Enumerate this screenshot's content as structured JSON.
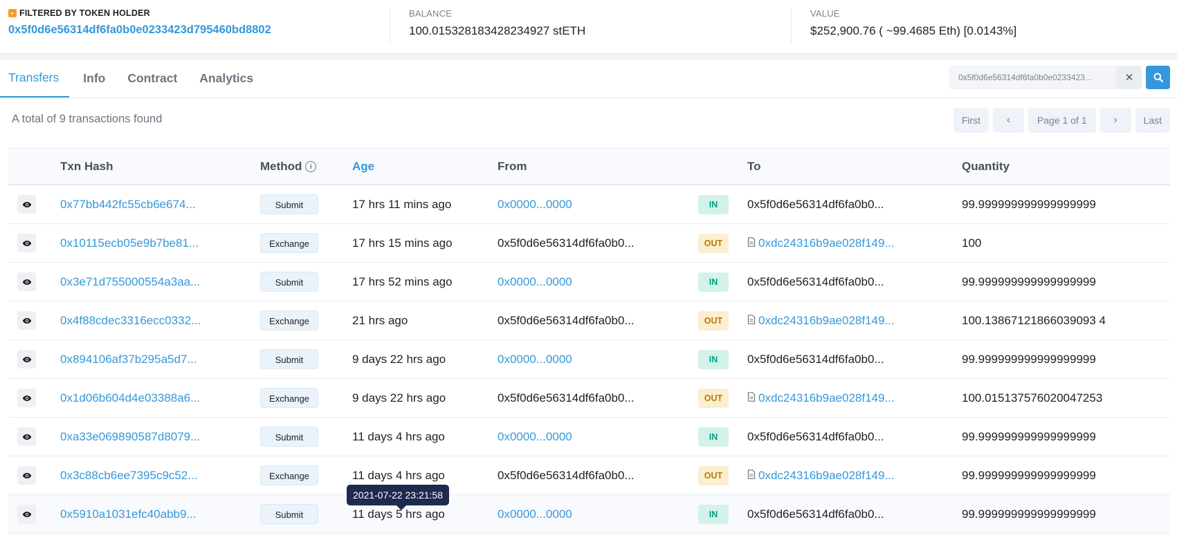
{
  "summary": {
    "filter_label": "FILTERED BY TOKEN HOLDER",
    "filter_address": "0x5f0d6e56314df6fa0b0e0233423d795460bd8802",
    "balance_label": "BALANCE",
    "balance_value": "100.015328183428234927 stETH",
    "value_label": "VALUE",
    "value_value": "$252,900.76 ( ~99.4685 Eth) [0.0143%]"
  },
  "tabs": [
    {
      "label": "Transfers",
      "active": true
    },
    {
      "label": "Info",
      "active": false
    },
    {
      "label": "Contract",
      "active": false
    },
    {
      "label": "Analytics",
      "active": false
    }
  ],
  "search": {
    "value": "0x5f0d6e56314df6fa0b0e0233423d795460bd8802",
    "display": "0x5f0d6e56314df6fa0b0e0233423..."
  },
  "total_text": "A total of 9 transactions found",
  "pager": {
    "first": "First",
    "prev": "‹",
    "info": "Page 1 of 1",
    "next": "›",
    "last": "Last"
  },
  "table": {
    "headers": {
      "txn_hash": "Txn Hash",
      "method": "Method",
      "age": "Age",
      "from": "From",
      "to": "To",
      "quantity": "Quantity"
    },
    "rows": [
      {
        "hash": "0x77bb442fc55cb6e674...",
        "method": "Submit",
        "age": "17 hrs 11 mins ago",
        "from": "0x0000...0000",
        "from_link": true,
        "dir": "IN",
        "to": "0x5f0d6e56314df6fa0b0...",
        "to_contract": false,
        "qty": "99.999999999999999999"
      },
      {
        "hash": "0x10115ecb05e9b7be81...",
        "method": "Exchange",
        "age": "17 hrs 15 mins ago",
        "from": "0x5f0d6e56314df6fa0b0...",
        "from_link": false,
        "dir": "OUT",
        "to": "0xdc24316b9ae028f149...",
        "to_contract": true,
        "qty": "100"
      },
      {
        "hash": "0x3e71d755000554a3aa...",
        "method": "Submit",
        "age": "17 hrs 52 mins ago",
        "from": "0x0000...0000",
        "from_link": true,
        "dir": "IN",
        "to": "0x5f0d6e56314df6fa0b0...",
        "to_contract": false,
        "qty": "99.999999999999999999"
      },
      {
        "hash": "0x4f88cdec3316ecc0332...",
        "method": "Exchange",
        "age": "21 hrs ago",
        "from": "0x5f0d6e56314df6fa0b0...",
        "from_link": false,
        "dir": "OUT",
        "to": "0xdc24316b9ae028f149...",
        "to_contract": true,
        "qty": "100.13867121866039093 4"
      },
      {
        "hash": "0x894106af37b295a5d7...",
        "method": "Submit",
        "age": "9 days 22 hrs ago",
        "from": "0x0000...0000",
        "from_link": true,
        "dir": "IN",
        "to": "0x5f0d6e56314df6fa0b0...",
        "to_contract": false,
        "qty": "99.999999999999999999"
      },
      {
        "hash": "0x1d06b604d4e03388a6...",
        "method": "Exchange",
        "age": "9 days 22 hrs ago",
        "from": "0x5f0d6e56314df6fa0b0...",
        "from_link": false,
        "dir": "OUT",
        "to": "0xdc24316b9ae028f149...",
        "to_contract": true,
        "qty": "100.015137576020047253"
      },
      {
        "hash": "0xa33e069890587d8079...",
        "method": "Submit",
        "age": "11 days 4 hrs ago",
        "from": "0x0000...0000",
        "from_link": true,
        "dir": "IN",
        "to": "0x5f0d6e56314df6fa0b0...",
        "to_contract": false,
        "qty": "99.999999999999999999"
      },
      {
        "hash": "0x3c88cb6ee7395c9c52...",
        "method": "Exchange",
        "age": "11 days 4 hrs ago",
        "from": "0x5f0d6e56314df6fa0b0...",
        "from_link": false,
        "dir": "OUT",
        "to": "0xdc24316b9ae028f149...",
        "to_contract": true,
        "qty": "99.999999999999999999"
      },
      {
        "hash": "0x5910a1031efc40abb9...",
        "method": "Submit",
        "age": "11 days 5 hrs ago",
        "from": "0x0000...0000",
        "from_link": true,
        "dir": "IN",
        "to": "0x5f0d6e56314df6fa0b0...",
        "to_contract": false,
        "qty": "99.999999999999999999"
      }
    ]
  },
  "tooltip": "2021-07-22 23:21:58",
  "colors": {
    "accent": "#3498db",
    "in_bg": "#d3f2ea",
    "in_text": "#00a186",
    "out_bg": "#fbeed1",
    "out_text": "#b47d00",
    "tooltip_bg": "#1e2a50"
  }
}
